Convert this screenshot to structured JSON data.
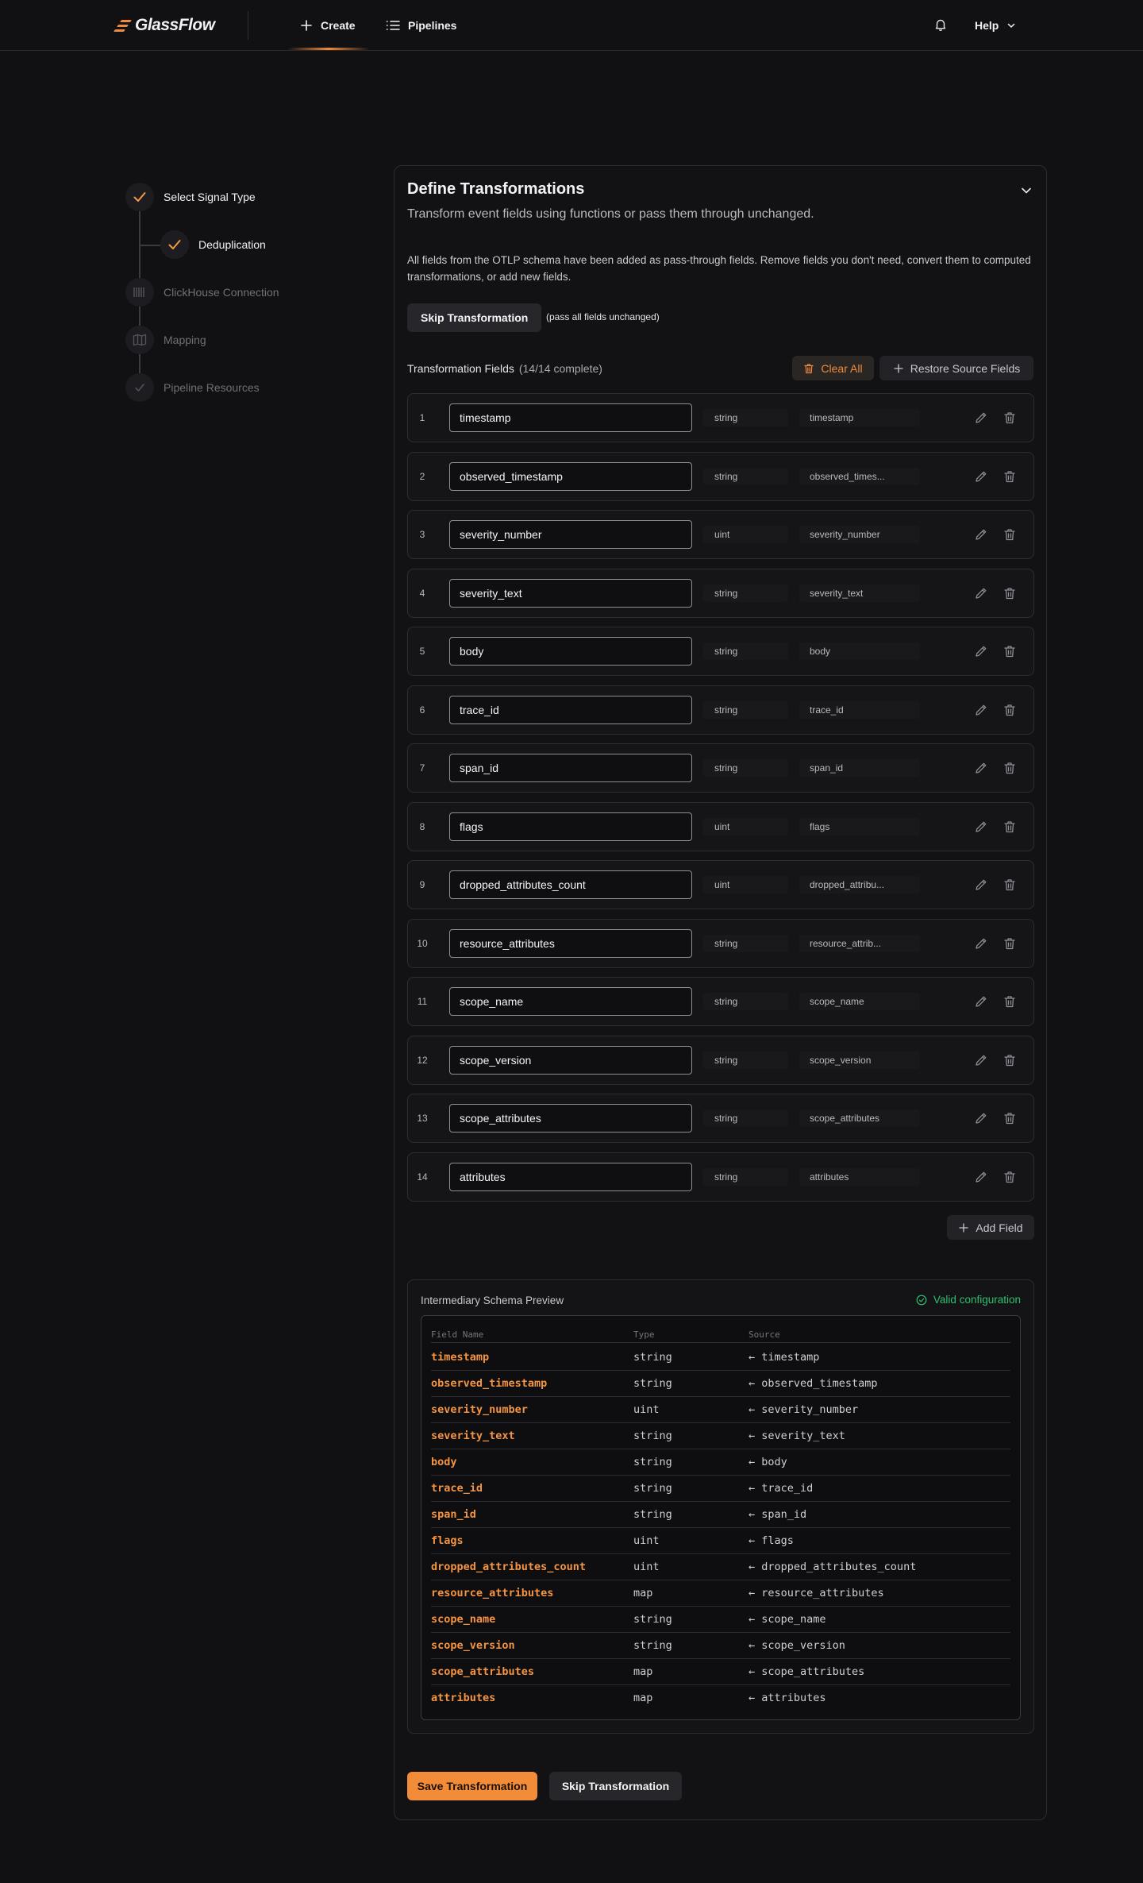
{
  "header": {
    "logo_text": "GlassFlow",
    "nav": {
      "create": "Create",
      "pipelines": "Pipelines"
    },
    "help_label": "Help",
    "accent": "#f08a3c"
  },
  "stepper": {
    "steps": [
      {
        "label": "Select Signal Type",
        "status": "done",
        "icon": "check-icon"
      },
      {
        "label": "Deduplication",
        "status": "done",
        "icon": "check-icon"
      },
      {
        "label": "ClickHouse Connection",
        "status": "pending",
        "icon": "barcode-icon"
      },
      {
        "label": "Mapping",
        "status": "pending",
        "icon": "map-icon"
      },
      {
        "label": "Pipeline Resources",
        "status": "pending",
        "icon": "check-icon"
      }
    ]
  },
  "card": {
    "title": "Define Transformations",
    "subtitle": "Transform event fields using functions or pass them through unchanged.",
    "description": "All fields from the OTLP schema have been added as pass-through fields. Remove fields you don't need, convert them to computed transformations, or add new fields.",
    "skip_button": "Skip Transformation",
    "skip_note": "(pass all fields unchanged)",
    "fields_title": "Transformation Fields",
    "fields_count": "(14/14 complete)",
    "clear_all": "Clear All",
    "restore": "Restore Source Fields",
    "add_field": "Add Field",
    "fields": [
      {
        "num": "1",
        "name": "timestamp",
        "type": "string",
        "source": "timestamp"
      },
      {
        "num": "2",
        "name": "observed_timestamp",
        "type": "string",
        "source": "observed_times..."
      },
      {
        "num": "3",
        "name": "severity_number",
        "type": "uint",
        "source": "severity_number"
      },
      {
        "num": "4",
        "name": "severity_text",
        "type": "string",
        "source": "severity_text"
      },
      {
        "num": "5",
        "name": "body",
        "type": "string",
        "source": "body"
      },
      {
        "num": "6",
        "name": "trace_id",
        "type": "string",
        "source": "trace_id"
      },
      {
        "num": "7",
        "name": "span_id",
        "type": "string",
        "source": "span_id"
      },
      {
        "num": "8",
        "name": "flags",
        "type": "uint",
        "source": "flags"
      },
      {
        "num": "9",
        "name": "dropped_attributes_count",
        "type": "uint",
        "source": "dropped_attribu..."
      },
      {
        "num": "10",
        "name": "resource_attributes",
        "type": "string",
        "source": "resource_attrib..."
      },
      {
        "num": "11",
        "name": "scope_name",
        "type": "string",
        "source": "scope_name"
      },
      {
        "num": "12",
        "name": "scope_version",
        "type": "string",
        "source": "scope_version"
      },
      {
        "num": "13",
        "name": "scope_attributes",
        "type": "string",
        "source": "scope_attributes"
      },
      {
        "num": "14",
        "name": "attributes",
        "type": "string",
        "source": "attributes"
      }
    ],
    "preview": {
      "title": "Intermediary Schema Preview",
      "valid": "Valid configuration",
      "headers": {
        "name": "Field Name",
        "type": "Type",
        "source": "Source"
      },
      "rows": [
        {
          "name": "timestamp",
          "type": "string",
          "source": "← timestamp"
        },
        {
          "name": "observed_timestamp",
          "type": "string",
          "source": "← observed_timestamp"
        },
        {
          "name": "severity_number",
          "type": "uint",
          "source": "← severity_number"
        },
        {
          "name": "severity_text",
          "type": "string",
          "source": "← severity_text"
        },
        {
          "name": "body",
          "type": "string",
          "source": "← body"
        },
        {
          "name": "trace_id",
          "type": "string",
          "source": "← trace_id"
        },
        {
          "name": "span_id",
          "type": "string",
          "source": "← span_id"
        },
        {
          "name": "flags",
          "type": "uint",
          "source": "← flags"
        },
        {
          "name": "dropped_attributes_count",
          "type": "uint",
          "source": "← dropped_attributes_count"
        },
        {
          "name": "resource_attributes",
          "type": "map",
          "source": "← resource_attributes"
        },
        {
          "name": "scope_name",
          "type": "string",
          "source": "← scope_name"
        },
        {
          "name": "scope_version",
          "type": "string",
          "source": "← scope_version"
        },
        {
          "name": "scope_attributes",
          "type": "map",
          "source": "← scope_attributes"
        },
        {
          "name": "attributes",
          "type": "map",
          "source": "← attributes"
        }
      ]
    },
    "save_button": "Save Transformation",
    "skip_button_bottom": "Skip Transformation"
  }
}
